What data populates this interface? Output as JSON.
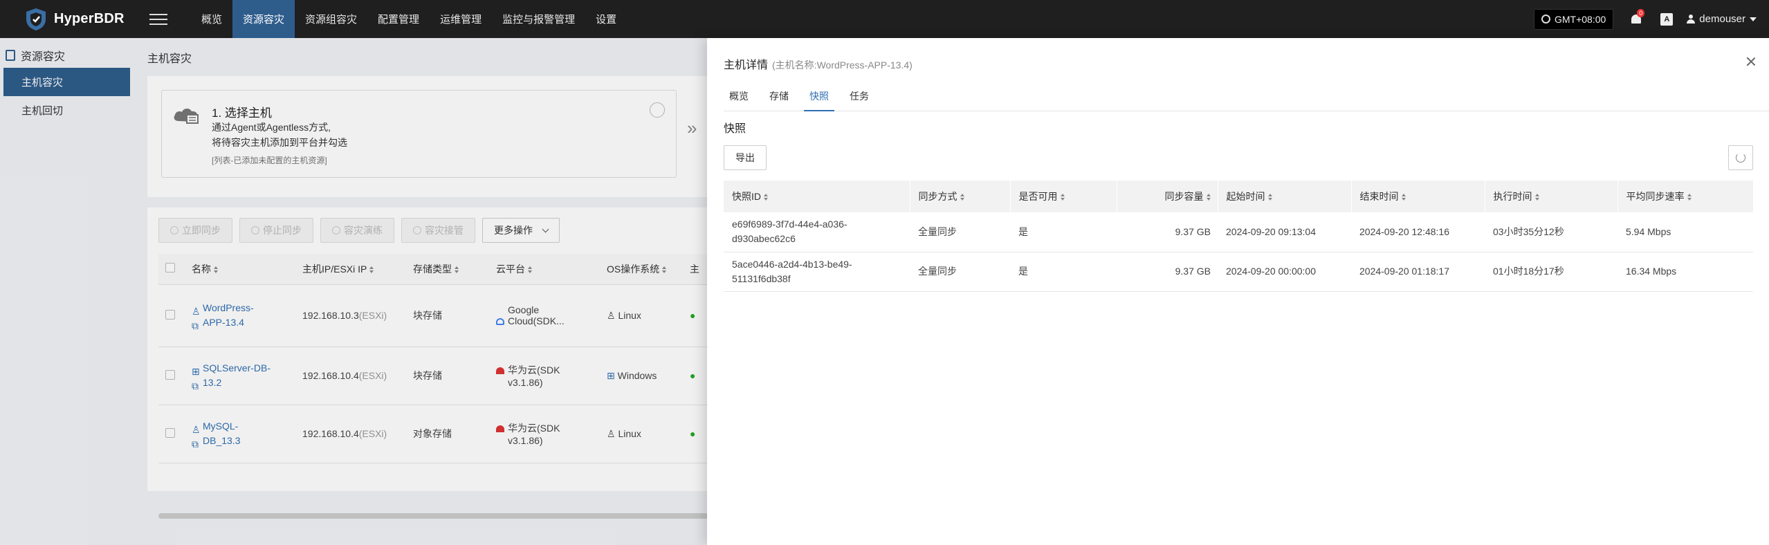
{
  "app": {
    "name": "HyperBDR"
  },
  "nav": [
    {
      "label": "概览",
      "active": false
    },
    {
      "label": "资源容灾",
      "active": true
    },
    {
      "label": "资源组容灾",
      "active": false
    },
    {
      "label": "配置管理",
      "active": false
    },
    {
      "label": "运维管理",
      "active": false
    },
    {
      "label": "监控与报警管理",
      "active": false
    },
    {
      "label": "设置",
      "active": false
    }
  ],
  "topright": {
    "timezone": "GMT+08:00",
    "notification_count": "0",
    "lang_icon": "A",
    "username": "demouser"
  },
  "sidebar": {
    "header": "资源容灾",
    "items": [
      {
        "label": "主机容灾",
        "active": true
      },
      {
        "label": "主机回切",
        "active": false
      }
    ]
  },
  "main": {
    "title": "主机容灾",
    "step": {
      "title": "1. 选择主机",
      "desc_line1": "通过Agent或Agentless方式,",
      "desc_line2": "将待容灾主机添加到平台并勾选",
      "note": "[列表-已添加未配置的主机资源]"
    },
    "toolbar": [
      "立即同步",
      "停止同步",
      "容灾演练",
      "容灾接管"
    ],
    "more_ops": "更多操作",
    "columns": [
      "名称",
      "主机IP/ESXi IP",
      "存储类型",
      "云平台",
      "OS操作系统",
      "主"
    ],
    "rows": [
      {
        "name1": "WordPress-",
        "name2": "APP-13.4",
        "ip": "192.168.10.3",
        "esxi": "(ESXi)",
        "storage": "块存储",
        "cloud1": "Google",
        "cloud2": "Cloud(SDK...",
        "os": "Linux"
      },
      {
        "name1": "SQLServer-DB-",
        "name2": "13.2",
        "ip": "192.168.10.4",
        "esxi": "(ESXi)",
        "storage": "块存储",
        "cloud1": "华为云(SDK",
        "cloud2": "v3.1.86)",
        "os": "Windows"
      },
      {
        "name1": "MySQL-",
        "name2": "DB_13.3",
        "ip": "192.168.10.4",
        "esxi": "(ESXi)",
        "storage": "对象存储",
        "cloud1": "华为云(SDK",
        "cloud2": "v3.1.86)",
        "os": "Linux"
      }
    ]
  },
  "drawer": {
    "title": "主机详情",
    "subtitle": "(主机名称:WordPress-APP-13.4)",
    "tabs": [
      {
        "label": "概览",
        "active": false
      },
      {
        "label": "存储",
        "active": false
      },
      {
        "label": "快照",
        "active": true
      },
      {
        "label": "任务",
        "active": false
      }
    ],
    "section": "快照",
    "export": "导出",
    "columns": [
      "快照ID",
      "同步方式",
      "是否可用",
      "同步容量",
      "起始时间",
      "结束时间",
      "执行时间",
      "平均同步速率"
    ],
    "rows": [
      {
        "id1": "e69f6989-3f7d-44e4-a036-",
        "id2": "d930abec62c6",
        "mode": "全量同步",
        "available": "是",
        "size": "9.37 GB",
        "start": "2024-09-20 09:13:04",
        "end": "2024-09-20 12:48:16",
        "duration": "03小时35分12秒",
        "speed": "5.94 Mbps"
      },
      {
        "id1": "5ace0446-a2d4-4b13-be49-",
        "id2": "51131f6db38f",
        "mode": "全量同步",
        "available": "是",
        "size": "9.37 GB",
        "start": "2024-09-20 00:00:00",
        "end": "2024-09-20 01:18:17",
        "duration": "01小时18分17秒",
        "speed": "16.34 Mbps"
      }
    ]
  },
  "colors": {
    "topbar": "#1f1f1f",
    "accent": "#2e5d8c",
    "link": "#2f6fb3"
  }
}
